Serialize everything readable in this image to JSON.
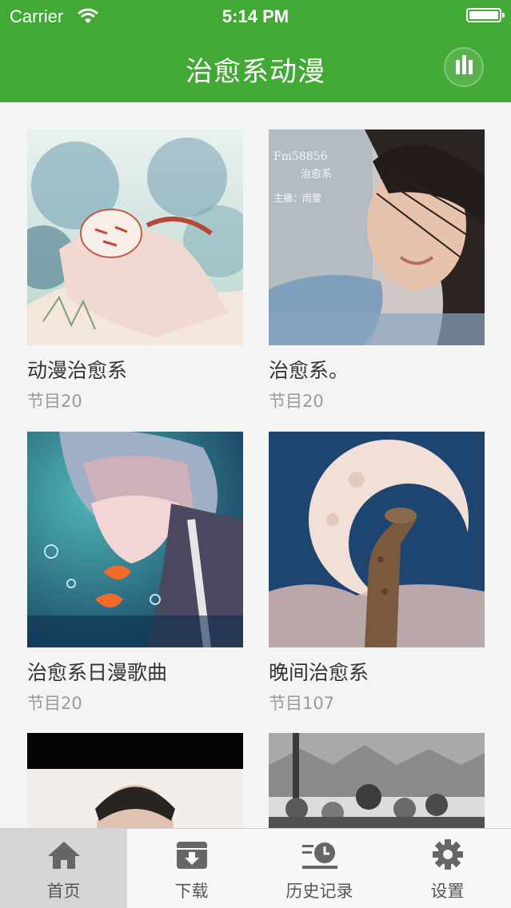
{
  "status_bar": {
    "carrier": "Carrier",
    "time": "5:14 PM"
  },
  "nav": {
    "title": "治愈系动漫",
    "action_icon": "now-playing-bars-icon"
  },
  "albums": [
    {
      "title": "动漫治愈系",
      "count_label": "节目",
      "count": "20"
    },
    {
      "title": "治愈系。",
      "count_label": "节目",
      "count": "20",
      "cover_text": [
        "Fm58856",
        "治愈系",
        "主播：雨萱"
      ]
    },
    {
      "title": "治愈系日漫歌曲",
      "count_label": "节目",
      "count": "20"
    },
    {
      "title": "晚间治愈系",
      "count_label": "节目",
      "count": "107"
    },
    {
      "title": "",
      "count_label": "",
      "count": ""
    },
    {
      "title": "",
      "count_label": "",
      "count": ""
    }
  ],
  "tabs": [
    {
      "label": "首页",
      "icon": "home-icon",
      "active": true
    },
    {
      "label": "下载",
      "icon": "download-box-icon",
      "active": false
    },
    {
      "label": "历史记录",
      "icon": "history-clock-icon",
      "active": false
    },
    {
      "label": "设置",
      "icon": "gear-icon",
      "active": false
    }
  ],
  "colors": {
    "brand_green": "#43a935",
    "background": "#f4f4f4",
    "tab_active_bg": "#d5d5d5"
  }
}
